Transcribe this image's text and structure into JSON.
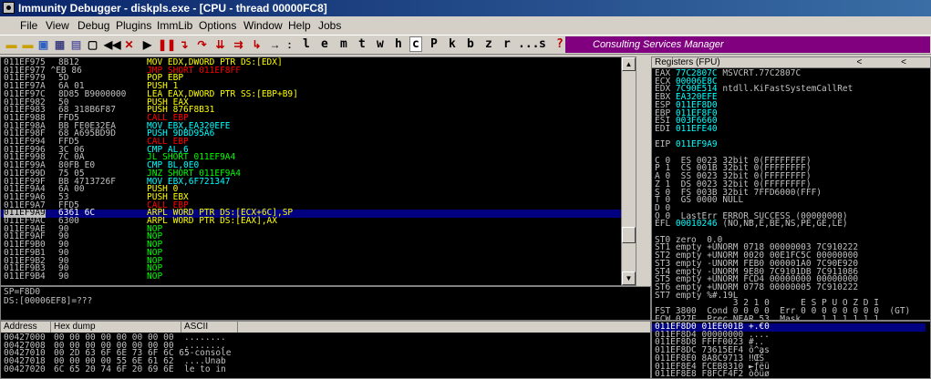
{
  "window": {
    "title": "Immunity Debugger - diskpls.exe - [CPU - thread 00000FC8]"
  },
  "menu": [
    "File",
    "View",
    "Debug",
    "Plugins",
    "ImmLib",
    "Options",
    "Window",
    "Help",
    "Jobs"
  ],
  "toolbar": {
    "letters": [
      "l",
      "e",
      "m",
      "t",
      "w",
      "h",
      "c",
      "P",
      "k",
      "b",
      "z",
      "r",
      "...",
      "s",
      "?"
    ],
    "pressed_letter": "c",
    "banner": "Consulting Services Manager",
    "banner_color": "#800080"
  },
  "disassembly": [
    {
      "addr": "011EF975",
      "hex": "8B12",
      "asm": "MOV EDX,DWORD PTR DS:[EDX]",
      "color": "#ffff00"
    },
    {
      "addr": "011EF977 ^EB 86",
      "hex": "",
      "asm": "JMP SHORT 011EF8FF",
      "color": "#ff0000"
    },
    {
      "addr": "011EF979",
      "hex": "5D",
      "asm": "POP EBP",
      "color": "#ffff00"
    },
    {
      "addr": "011EF97A",
      "hex": "6A 01",
      "asm": "PUSH 1",
      "color": "#ffff00"
    },
    {
      "addr": "011EF97C",
      "hex": "8D85 B9000000",
      "asm": "LEA EAX,DWORD PTR SS:[EBP+B9]",
      "color": "#ffff00"
    },
    {
      "addr": "011EF982",
      "hex": "50",
      "asm": "PUSH EAX",
      "color": "#ffff00"
    },
    {
      "addr": "011EF983",
      "hex": "68 318B6F87",
      "asm": "PUSH 876F8B31",
      "color": "#ffff00"
    },
    {
      "addr": "011EF988",
      "hex": "FFD5",
      "asm": "CALL EBP",
      "color": "#ff0000"
    },
    {
      "addr": "011EF98A",
      "hex": "BB FE0E32EA",
      "asm": "MOV EBX,EA320EFE",
      "color": "#00ffff"
    },
    {
      "addr": "011EF98F",
      "hex": "68 A695BD9D",
      "asm": "PUSH 9DBD95A6",
      "color": "#00ffff"
    },
    {
      "addr": "011EF994",
      "hex": "FFD5",
      "asm": "CALL EBP",
      "color": "#ff0000"
    },
    {
      "addr": "011EF996",
      "hex": "3C 06",
      "asm": "CMP AL,6",
      "color": "#00ffff"
    },
    {
      "addr": "011EF998",
      "hex": "7C 0A",
      "asm": "JL SHORT 011EF9A4",
      "color": "#00ff00"
    },
    {
      "addr": "011EF99A",
      "hex": "80FB E0",
      "asm": "CMP BL,0E0",
      "color": "#00ffff"
    },
    {
      "addr": "011EF99D",
      "hex": "75 05",
      "asm": "JNZ SHORT 011EF9A4",
      "color": "#00ff00"
    },
    {
      "addr": "011EF99F",
      "hex": "BB 4713726F",
      "asm": "MOV EBX,6F721347",
      "color": "#00ffff"
    },
    {
      "addr": "011EF9A4",
      "hex": "6A 00",
      "asm": "PUSH 0",
      "color": "#ffff00"
    },
    {
      "addr": "011EF9A6",
      "hex": "53",
      "asm": "PUSH EBX",
      "color": "#ffff00"
    },
    {
      "addr": "011EF9A7",
      "hex": "FFD5",
      "asm": "CALL EBP",
      "color": "#ff0000"
    },
    {
      "addr": "011EF9A9",
      "hex": "6361 6C",
      "asm": "ARPL WORD PTR DS:[ECX+6C],SP",
      "color": "#ffff00",
      "selected": true
    },
    {
      "addr": "011EF9AC",
      "hex": "6300",
      "asm": "ARPL WORD PTR DS:[EAX],AX",
      "color": "#ffff00"
    },
    {
      "addr": "011EF9AE",
      "hex": "90",
      "asm": "NOP",
      "color": "#00ff00"
    },
    {
      "addr": "011EF9AF",
      "hex": "90",
      "asm": "NOP",
      "color": "#00ff00"
    },
    {
      "addr": "011EF9B0",
      "hex": "90",
      "asm": "NOP",
      "color": "#00ff00"
    },
    {
      "addr": "011EF9B1",
      "hex": "90",
      "asm": "NOP",
      "color": "#00ff00"
    },
    {
      "addr": "011EF9B2",
      "hex": "90",
      "asm": "NOP",
      "color": "#00ff00"
    },
    {
      "addr": "011EF9B3",
      "hex": "90",
      "asm": "NOP",
      "color": "#00ff00"
    },
    {
      "addr": "011EF9B4",
      "hex": "90",
      "asm": "NOP",
      "color": "#00ff00"
    }
  ],
  "info": [
    "SP=F8D0",
    "DS:[00006EF8]=???"
  ],
  "dump": {
    "headers": [
      "Address",
      "Hex dump",
      "ASCII"
    ],
    "rows": [
      {
        "addr": "00427000",
        "hex": "00 00 00 00 00 00 00 00",
        "ascii": "........"
      },
      {
        "addr": "00427008",
        "hex": "00 00 00 00 00 00 00 00",
        "ascii": "........"
      },
      {
        "addr": "00427010",
        "hex": "00 2D 63 6F 6E 73 6F 6C 65",
        "ascii": ".-console"
      },
      {
        "addr": "00427018",
        "hex": "00 00 00 00 55 6E 61 62",
        "ascii": "....Unab"
      },
      {
        "addr": "00427020",
        "hex": "6C 65 20 74 6F 20 69 6E",
        "ascii": "le to in"
      }
    ]
  },
  "registers": {
    "header": "Registers (FPU)",
    "header_buttons": "<  <",
    "gpr": [
      {
        "name": "EAX",
        "val": "77C2807C",
        "cmt": "MSVCRT.77C2807C"
      },
      {
        "name": "ECX",
        "val": "00006E8C",
        "cmt": ""
      },
      {
        "name": "EDX",
        "val": "7C90E514",
        "cmt": "ntdll.KiFastSystemCallRet"
      },
      {
        "name": "EBX",
        "val": "EA320EFE",
        "cmt": ""
      },
      {
        "name": "ESP",
        "val": "011EF8D0",
        "cmt": ""
      },
      {
        "name": "EBP",
        "val": "011EF8F0",
        "cmt": ""
      },
      {
        "name": "ESI",
        "val": "003F6660",
        "cmt": ""
      },
      {
        "name": "EDI",
        "val": "011EFE40",
        "cmt": ""
      }
    ],
    "eip": {
      "name": "EIP",
      "val": "011EF9A9"
    },
    "flags": [
      "C 0  ES 0023 32bit 0(FFFFFFFF)",
      "P 1  CS 001B 32bit 0(FFFFFFFF)",
      "A 0  SS 0023 32bit 0(FFFFFFFF)",
      "Z 1  DS 0023 32bit 0(FFFFFFFF)",
      "S 0  FS 003B 32bit 7FFD6000(FFF)",
      "T 0  GS 0000 NULL",
      "D 0",
      "O 0  LastErr ERROR_SUCCESS (00000000)"
    ],
    "efl": {
      "name": "EFL",
      "val": "00010246",
      "cmt": "(NO,NB,E,BE,NS,PE,GE,LE)"
    },
    "fpu": [
      "ST0 zero  0.0",
      "ST1 empty +UNORM 0718 00000003 7C910222",
      "ST2 empty +UNORM 0020 00E1FC5C 00000000",
      "ST3 empty -UNORM FEB0 000001A0 7C90E920",
      "ST4 empty -UNORM 9E80 7C9101DB 7C911086",
      "ST5 empty +UNORM FCD4 00000000 00000000",
      "ST6 empty +UNORM 0778 00000005 7C910222",
      "ST7 empty %#.19L",
      "               3 2 1 0      E S P U O Z D I",
      "FST 3800  Cond 0 0 0 0  Err 0 0 0 0 0 0 0 0  (GT)",
      "FCW 027F  Prec NEAR,53  Mask    1 1 1 1 1 1"
    ]
  },
  "stack": [
    {
      "addr": "011EF8D0",
      "val": "01EE001B",
      "cmt": "+.€0",
      "selected": true
    },
    {
      "addr": "011EF8D4",
      "val": "00000000",
      "cmt": "...."
    },
    {
      "addr": "011EF8D8",
      "val": "FFFF0023",
      "cmt": "#.."
    },
    {
      "addr": "011EF8DC",
      "val": "73615EF4",
      "cmt": "ō^as"
    },
    {
      "addr": "011EF8E0",
      "val": "8A8C9713",
      "cmt": "‼ŒŠ"
    },
    {
      "addr": "011EF8E4",
      "val": "FCEB8310",
      "cmt": "►ƒëü"
    },
    {
      "addr": "011EF8E8",
      "val": "F8FCF4F2",
      "cmt": "òôüø"
    }
  ]
}
